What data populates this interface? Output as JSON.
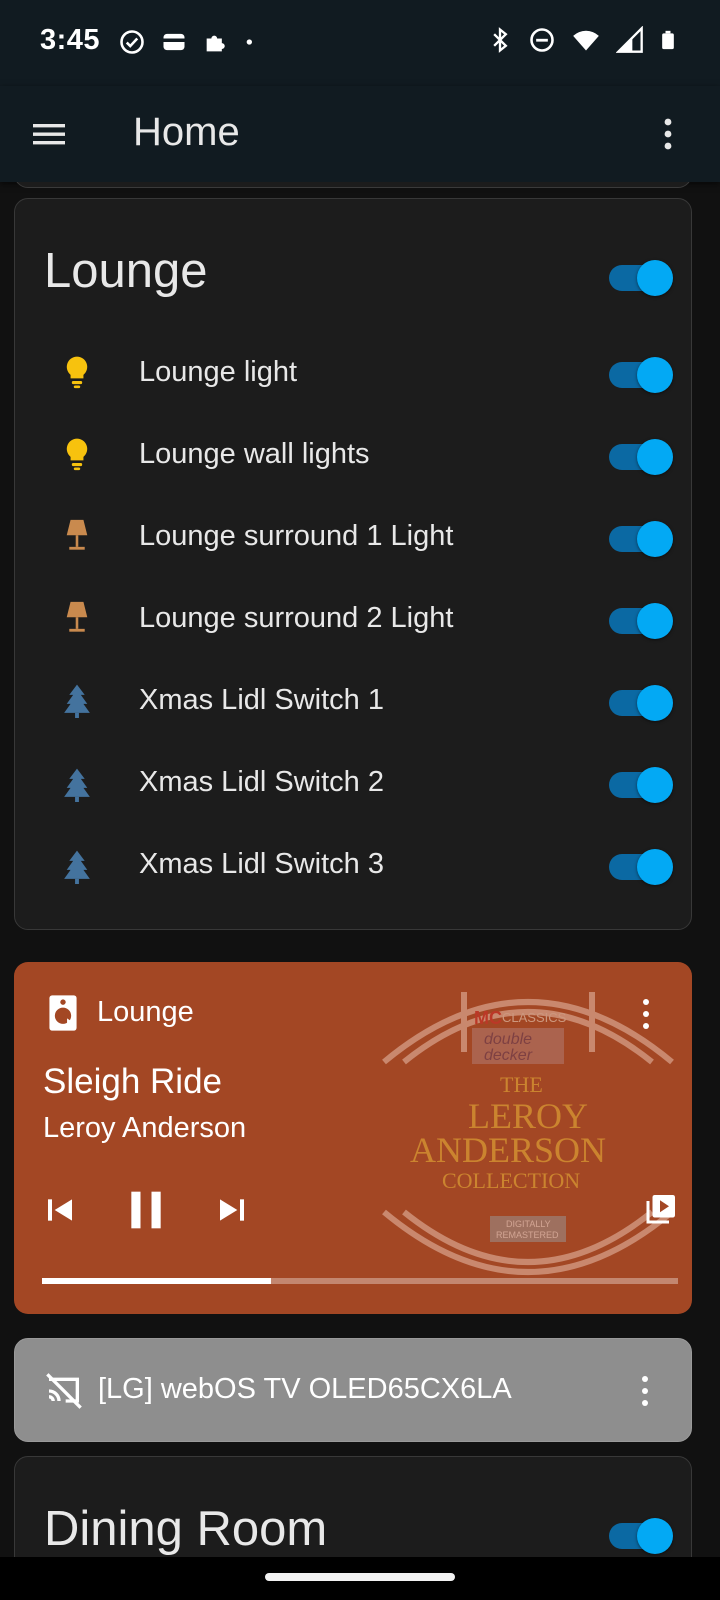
{
  "status_bar": {
    "time": "3:45",
    "left_icons": [
      "check-circle-icon",
      "wallet-icon",
      "puzzle-icon",
      "dot-icon"
    ],
    "right_icons": [
      "bluetooth-icon",
      "do-not-disturb-icon",
      "wifi-icon",
      "signal-icon",
      "battery-icon"
    ]
  },
  "app_bar": {
    "title": "Home",
    "menu_icon": "menu-icon",
    "overflow_icon": "more-vert-icon"
  },
  "lounge_card": {
    "title": "Lounge",
    "master_toggle_on": true,
    "entities": [
      {
        "label": "Lounge light",
        "icon": "lightbulb-icon",
        "icon_color": "#f7c20e",
        "on": true
      },
      {
        "label": "Lounge wall lights",
        "icon": "lightbulb-icon",
        "icon_color": "#f7c20e",
        "on": true
      },
      {
        "label": "Lounge surround 1 Light",
        "icon": "floor-lamp-icon",
        "icon_color": "#c98a4e",
        "on": true
      },
      {
        "label": "Lounge surround 2 Light",
        "icon": "floor-lamp-icon",
        "icon_color": "#c98a4e",
        "on": true
      },
      {
        "label": "Xmas Lidl Switch 1",
        "icon": "pine-tree-icon",
        "icon_color": "#44739e",
        "on": true
      },
      {
        "label": "Xmas Lidl Switch 2",
        "icon": "pine-tree-icon",
        "icon_color": "#44739e",
        "on": true
      },
      {
        "label": "Xmas Lidl Switch 3",
        "icon": "pine-tree-icon",
        "icon_color": "#44739e",
        "on": true
      }
    ]
  },
  "media_card": {
    "source": "Lounge",
    "title": "Sleigh Ride",
    "artist": "Leroy Anderson",
    "progress": 0.36,
    "background_color": "#a34724",
    "album_art": {
      "brand": "MC",
      "brand_suffix": "CLASSICS",
      "label_line1": "double",
      "label_line2": "decker",
      "title_line1": "THE",
      "title_line2": "LEROY",
      "title_line3": "ANDERSON",
      "title_line4": "COLLECTION",
      "badge_line1": "DIGITALLY",
      "badge_line2": "REMASTERED"
    }
  },
  "tv_card": {
    "label": "[LG] webOS TV OLED65CX6LA",
    "icon": "cast-off-icon"
  },
  "dining_card": {
    "title": "Dining Room",
    "master_toggle_on": true
  },
  "colors": {
    "toggle_track": "#0b69a3",
    "toggle_thumb": "#03a9f4",
    "card_bg": "#1c1c1c",
    "app_bar_bg": "#111b21"
  }
}
